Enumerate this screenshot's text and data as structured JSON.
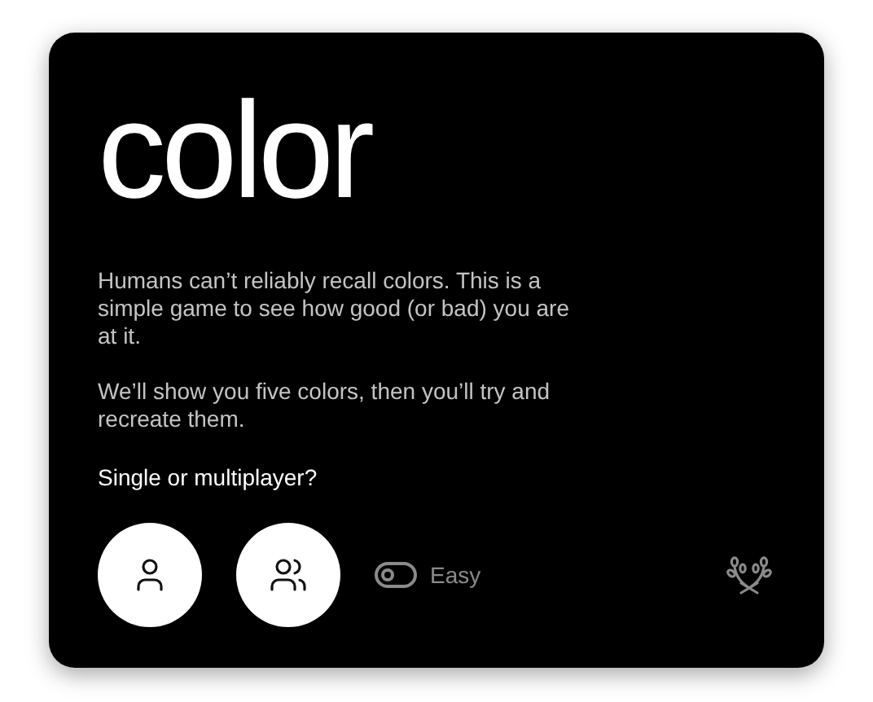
{
  "title": "color",
  "paragraphs": [
    "Humans can’t reliably recall colors. This is a simple game to see how good (or bad) you are at it.",
    "We’ll show you five colors, then you’ll try and recreate them."
  ],
  "prompt": "Single or multiplayer?",
  "mode_buttons": [
    {
      "kind": "single"
    },
    {
      "kind": "multi"
    }
  ],
  "difficulty_toggle": {
    "label": "Easy",
    "on": false
  }
}
